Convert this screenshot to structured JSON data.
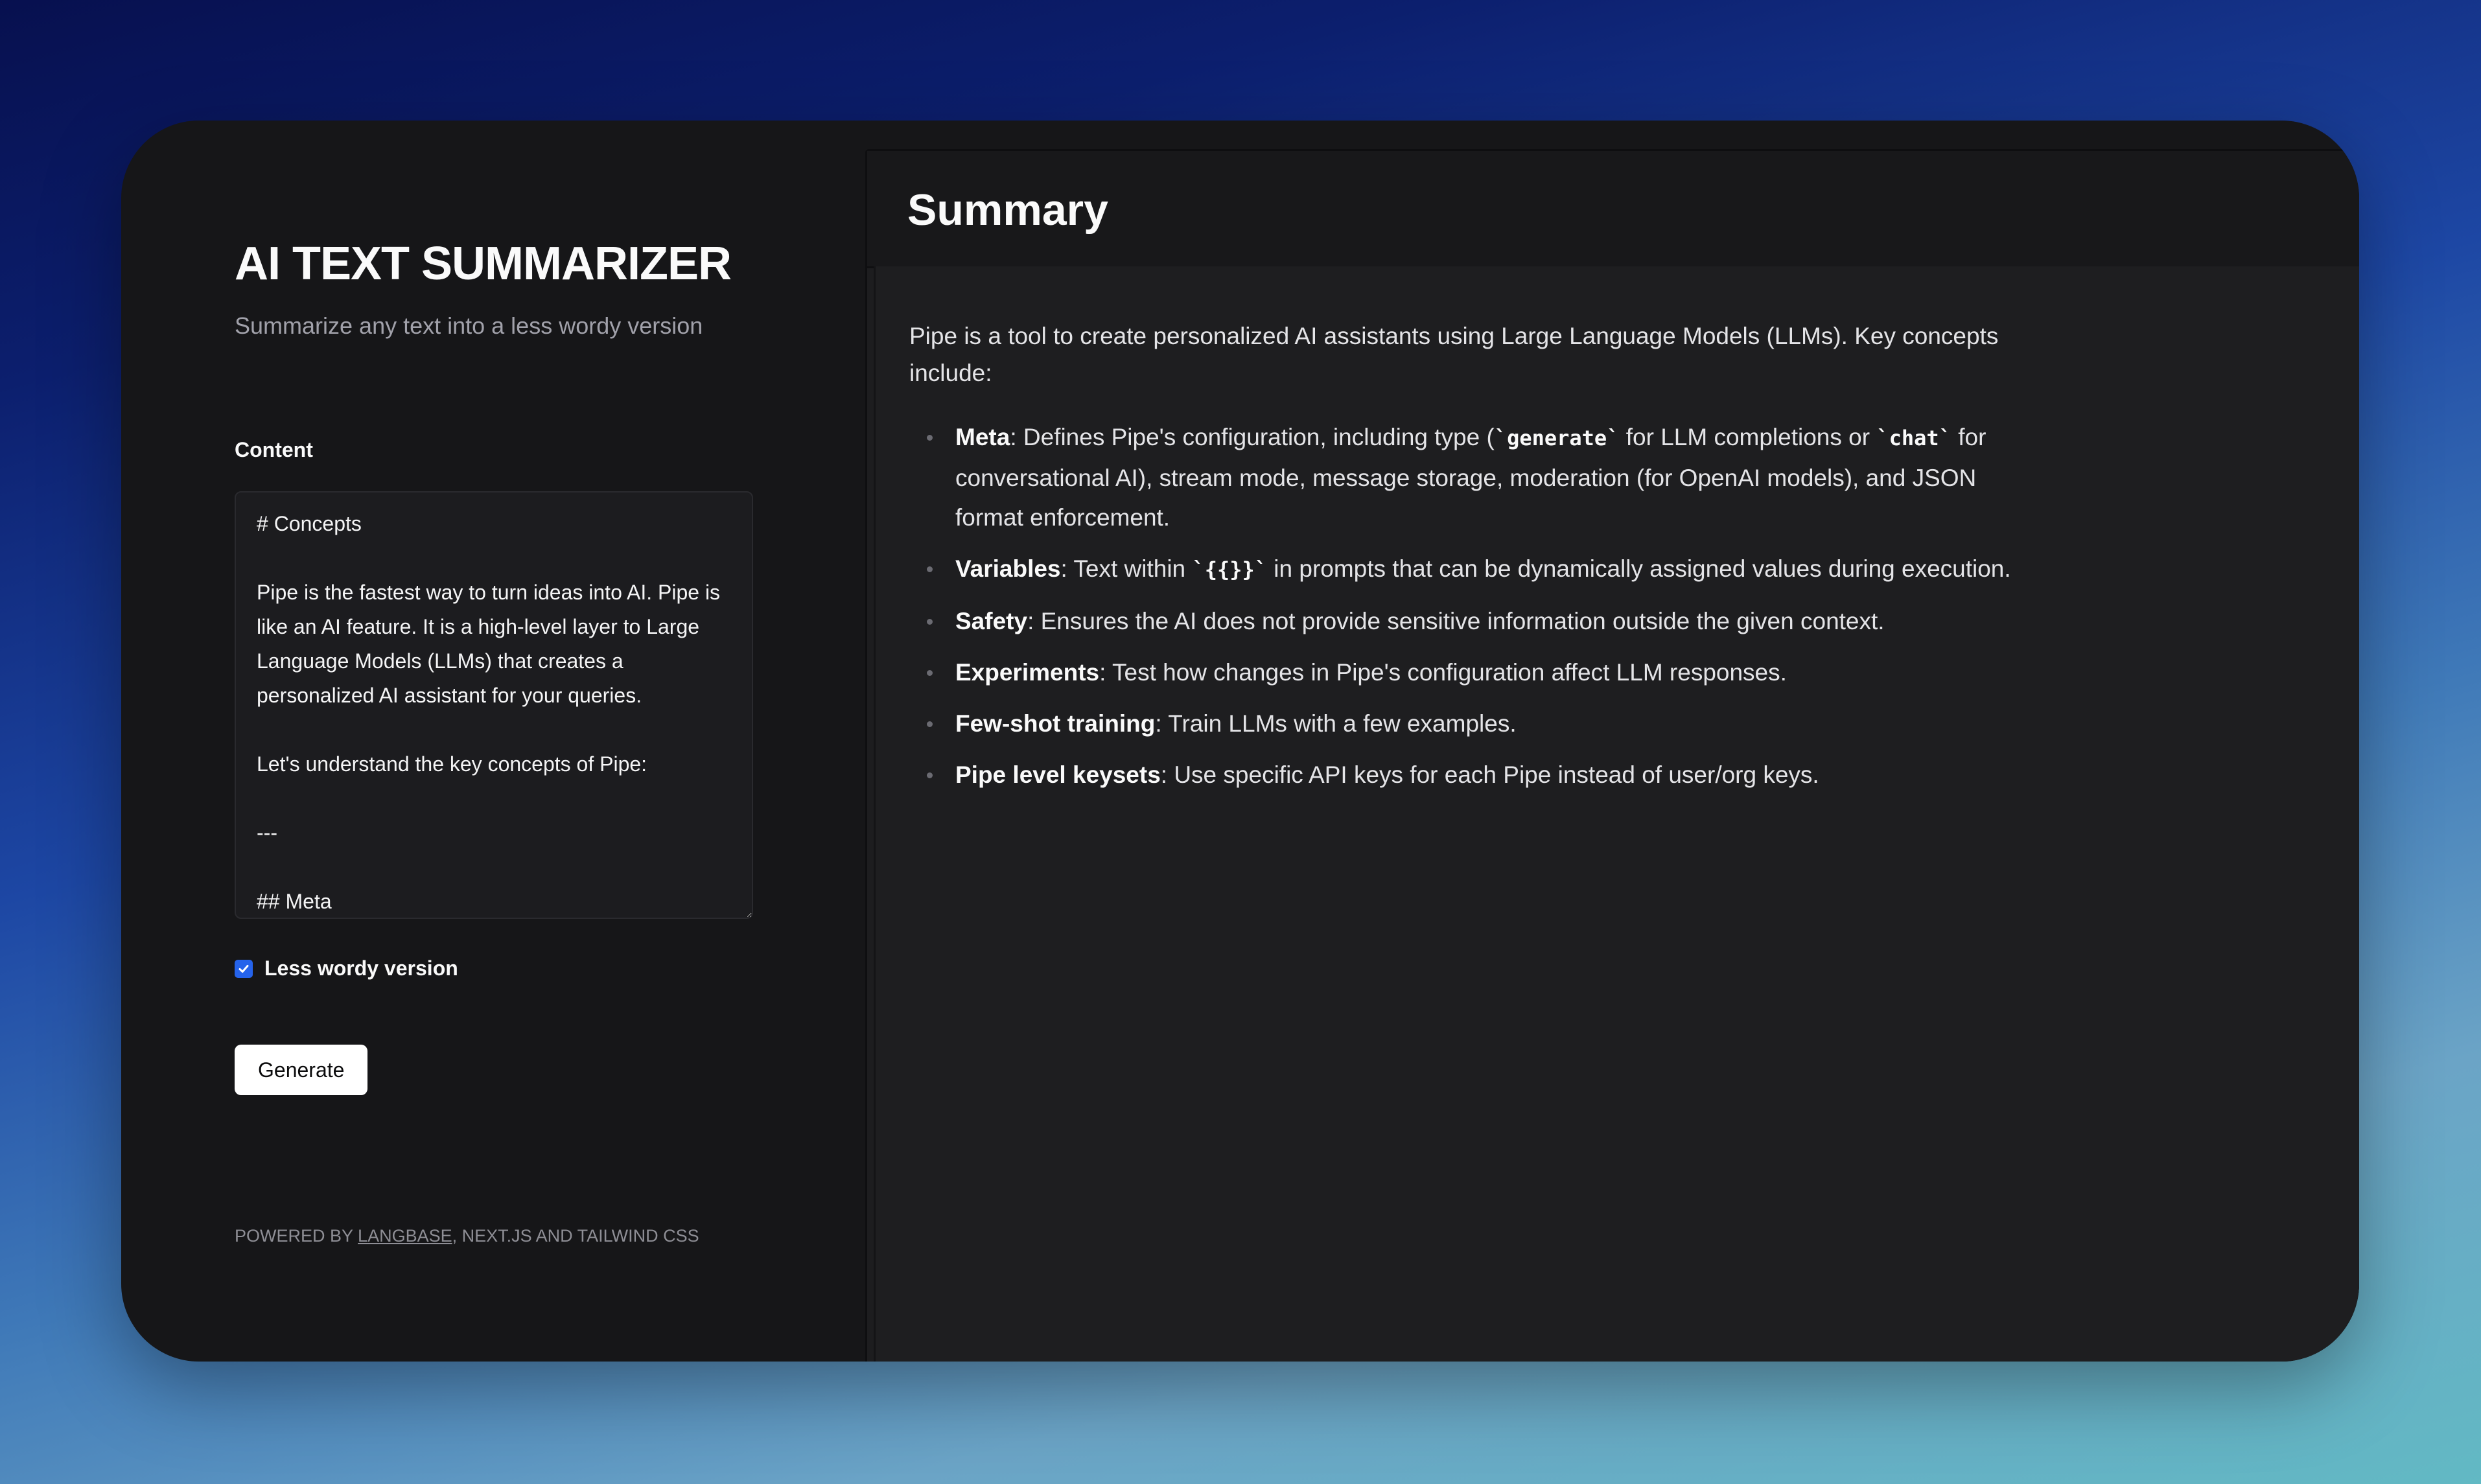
{
  "app": {
    "title": "AI TEXT SUMMARIZER",
    "subtitle": "Summarize any text into a less wordy version"
  },
  "form": {
    "content_label": "Content",
    "content_value": "# Concepts\n\nPipe is the fastest way to turn ideas into AI. Pipe is like an AI feature. It is a high-level layer to Large Language Models (LLMs) that creates a personalized AI assistant for your queries.\n\nLet's understand the key concepts of Pipe:\n\n---\n\n## Meta",
    "checkbox_label": "Less wordy version",
    "checkbox_checked": true,
    "generate_label": "Generate"
  },
  "footer": {
    "prefix": "POWERED BY ",
    "link": "LANGBASE",
    "suffix": ", NEXT.JS AND TAILWIND CSS"
  },
  "summary": {
    "title": "Summary",
    "intro": "Pipe is a tool to create personalized AI assistants using Large Language Models (LLMs). Key concepts include:",
    "items": [
      {
        "term": "Meta",
        "parts": [
          ": Defines Pipe's configuration, including type (",
          "`generate`",
          " for LLM completions or ",
          "`chat`",
          " for conversational AI), stream mode, message storage, moderation (for OpenAI models), and JSON format enforcement."
        ]
      },
      {
        "term": "Variables",
        "parts": [
          ": Text within ",
          "`{{}}`",
          " in prompts that can be dynamically assigned values during execution."
        ]
      },
      {
        "term": "Safety",
        "text": ": Ensures the AI does not provide sensitive information outside the given context."
      },
      {
        "term": "Experiments",
        "text": ": Test how changes in Pipe's configuration affect LLM responses."
      },
      {
        "term": "Few-shot training",
        "text": ": Train LLMs with a few examples."
      },
      {
        "term": "Pipe level keysets",
        "text": ": Use specific API keys for each Pipe instead of user/org keys."
      }
    ]
  },
  "colors": {
    "accent": "#2563eb",
    "panel": "#161618",
    "summary_bg": "#1e1e20"
  },
  "icons": {
    "checkbox": "check-icon"
  }
}
